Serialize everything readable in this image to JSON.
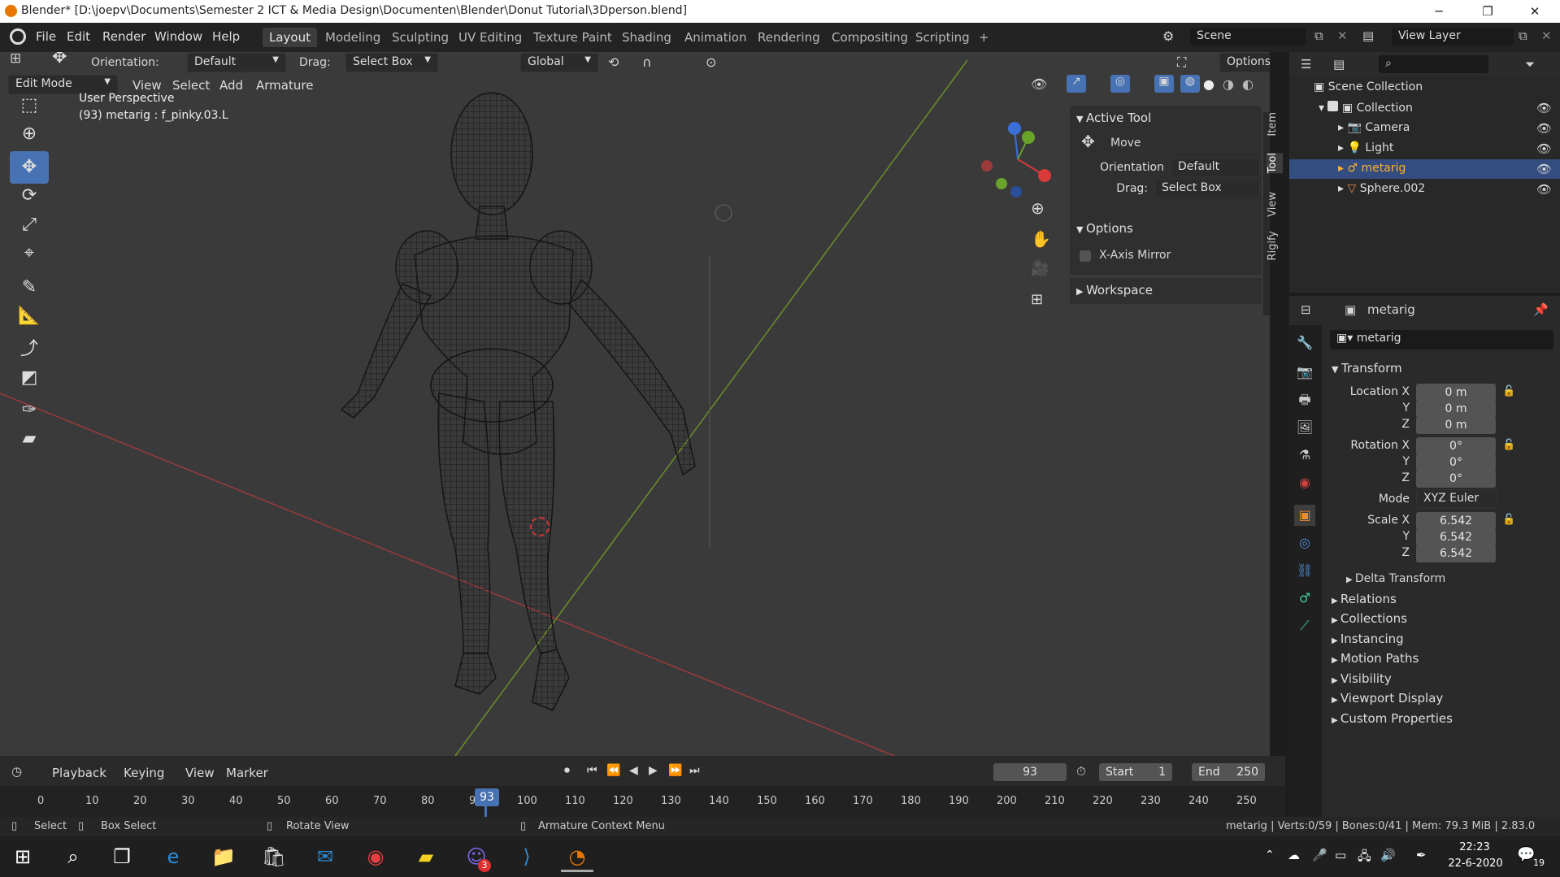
{
  "window": {
    "title": "Blender* [D:\\joepv\\Documents\\Semester 2 ICT & Media Design\\Documenten\\Blender\\Donut Tutorial\\3Dperson.blend]"
  },
  "menus": [
    "File",
    "Edit",
    "Render",
    "Window",
    "Help"
  ],
  "workspaces": [
    "Layout",
    "Modeling",
    "Sculpting",
    "UV Editing",
    "Texture Paint",
    "Shading",
    "Animation",
    "Rendering",
    "Compositing",
    "Scripting",
    "+"
  ],
  "scene": {
    "label": "Scene",
    "view_layer": "View Layer"
  },
  "toolheader": {
    "orientation_label": "Orientation:",
    "orientation_value": "Default",
    "drag_label": "Drag:",
    "drag_value": "Select Box",
    "transform_orientation": "Global",
    "options": "Options"
  },
  "viewport_header": {
    "mode": "Edit Mode",
    "menus": [
      "View",
      "Select",
      "Add",
      "Armature"
    ]
  },
  "viewport": {
    "perspective": "User Perspective",
    "object_info": "(93) metarig : f_pinky.03.L"
  },
  "npanel": {
    "tabs": [
      "Item",
      "Tool",
      "View",
      "Rigify"
    ],
    "active_tool": "Active Tool",
    "tool_name": "Move",
    "orientation_label": "Orientation",
    "orientation_value": "Default",
    "drag_label": "Drag:",
    "drag_value": "Select Box",
    "options": "Options",
    "xmirror": "X-Axis Mirror",
    "workspace": "Workspace"
  },
  "outliner": {
    "scene_collection": "Scene Collection",
    "collection": "Collection",
    "items": [
      "Camera",
      "Light",
      "metarig",
      "Sphere.002"
    ]
  },
  "properties": {
    "object_name": "metarig",
    "datablock": "metarig",
    "transform": "Transform",
    "location": {
      "label": "Location X",
      "x": "0 m",
      "y": "0 m",
      "z": "0 m"
    },
    "rotation": {
      "label": "Rotation X",
      "x": "0°",
      "y": "0°",
      "z": "0°"
    },
    "mode_label": "Mode",
    "mode_value": "XYZ Euler",
    "scale": {
      "label": "Scale X",
      "x": "6.542",
      "y": "6.542",
      "z": "6.542"
    },
    "axis_y": "Y",
    "axis_z": "Z",
    "delta": "Delta Transform",
    "sections": [
      "Relations",
      "Collections",
      "Instancing",
      "Motion Paths",
      "Visibility",
      "Viewport Display",
      "Custom Properties"
    ]
  },
  "timeline": {
    "menus": [
      "Playback",
      "Keying",
      "View",
      "Marker"
    ],
    "current_frame": "93",
    "start_label": "Start",
    "start": "1",
    "end_label": "End",
    "end": "250",
    "ticks": [
      "0",
      "10",
      "20",
      "30",
      "40",
      "50",
      "60",
      "70",
      "80",
      "90",
      "100",
      "110",
      "120",
      "130",
      "140",
      "150",
      "160",
      "170",
      "180",
      "190",
      "200",
      "210",
      "220",
      "230",
      "240",
      "250"
    ]
  },
  "status": {
    "select": "Select",
    "box_select": "Box Select",
    "rotate": "Rotate View",
    "context": "Armature Context Menu",
    "info": "metarig | Verts:0/59 | Bones:0/41 | Mem: 79.3 MiB | 2.83.0"
  },
  "taskbar": {
    "time": "22:23",
    "date": "22-6-2020",
    "notif": "19",
    "badge": "3"
  }
}
